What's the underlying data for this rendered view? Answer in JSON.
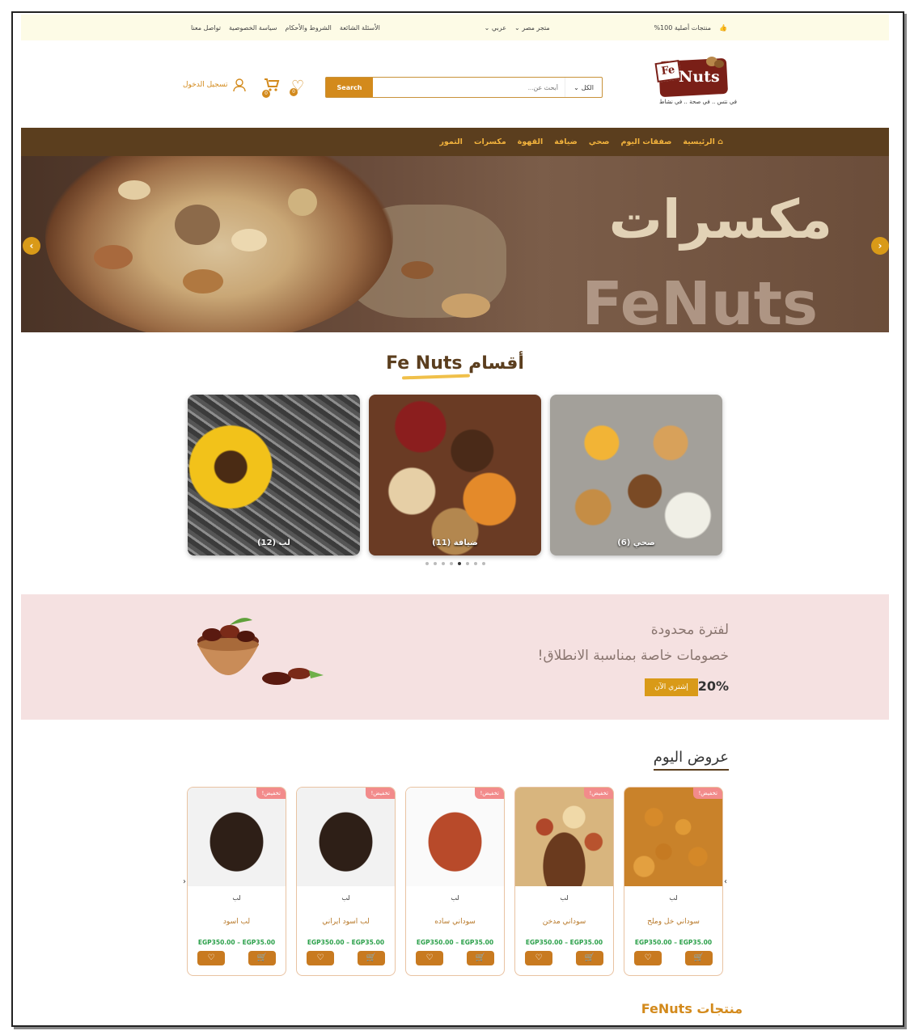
{
  "topbar": {
    "original": "منتجات أصلية 100%",
    "store": "متجر مصر",
    "lang": "عربي",
    "links": [
      "الأسئلة الشائعة",
      "الشروط والأحكام",
      "سياسة الخصوصية",
      "تواصل معنا"
    ]
  },
  "header": {
    "logo_fe": "Fe",
    "logo_nuts": "Nuts",
    "logo_tagline": "في نتس .. في صحة .. في نشاط",
    "search_category": "الكل",
    "search_placeholder": "أبحث عن...",
    "search_button": "Search",
    "wishlist_count": "0",
    "cart_count": "0",
    "login": "تسجيل الدخول"
  },
  "nav": {
    "items": [
      "الرئيسية",
      "صفقات اليوم",
      "صحي",
      "ضيافة",
      "القهوة",
      "مكسرات",
      "التمور"
    ]
  },
  "banner": {
    "title": "مكسرات",
    "subtitle": "FeNuts",
    "prev": "‹",
    "next": "›"
  },
  "categories": {
    "title_ar": "أقسام",
    "title_en": "Fe Nuts",
    "items": [
      {
        "label": "صحي (6)"
      },
      {
        "label": "ضيافة (11)"
      },
      {
        "label": "لب (12)"
      }
    ],
    "dots": 8,
    "active_dot": 4
  },
  "promo": {
    "line1": "لفترة محدودة",
    "line2": "خصومات خاصة بمناسبة الانطلاق!",
    "percent": "20%",
    "button": "إشتري الآن"
  },
  "offers": {
    "title": "عروض اليوم",
    "sale_label": "تخفيض!",
    "products": [
      {
        "category": "لب",
        "name": "سوداني خل وملح",
        "price": "EGP350.00 – EGP35.00"
      },
      {
        "category": "لب",
        "name": "سوداني مدخن",
        "price": "EGP350.00 – EGP35.00"
      },
      {
        "category": "لب",
        "name": "سوداني ساده",
        "price": "EGP350.00 – EGP35.00"
      },
      {
        "category": "لب",
        "name": "لب اسود ايراني",
        "price": "EGP350.00 – EGP35.00"
      },
      {
        "category": "لب",
        "name": "لب اسود",
        "price": "EGP350.00 – EGP35.00"
      }
    ]
  },
  "bottom": {
    "title": "منتجات FeNuts"
  },
  "colors": {
    "brand_brown": "#5b3e1e",
    "accent_orange": "#d38a1c",
    "nav_text": "#f2b23c",
    "sale_pink": "#f28b8b",
    "price_green": "#2ba04a",
    "promo_bg": "#f5e1e1"
  }
}
